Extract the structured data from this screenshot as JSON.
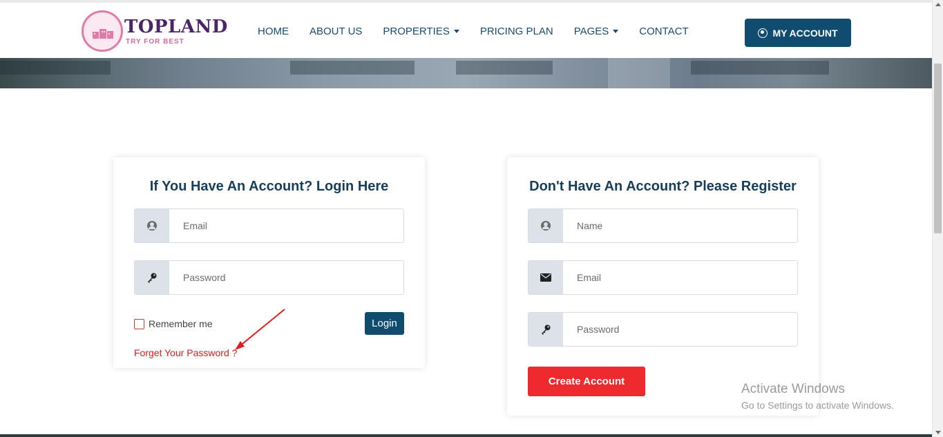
{
  "header": {
    "logo_title": "TOPLAND",
    "logo_tagline": "TRY FOR BEST",
    "nav": [
      {
        "label": "HOME",
        "dropdown": false
      },
      {
        "label": "ABOUT US",
        "dropdown": false
      },
      {
        "label": "PROPERTIES",
        "dropdown": true
      },
      {
        "label": "PRICING PLAN",
        "dropdown": false
      },
      {
        "label": "PAGES",
        "dropdown": true
      },
      {
        "label": "CONTACT",
        "dropdown": false
      }
    ],
    "account_button": "MY ACCOUNT"
  },
  "login": {
    "title": "If You Have An Account? Login Here",
    "email_placeholder": "Email",
    "password_placeholder": "Password",
    "remember_label": "Remember me",
    "login_button": "Login",
    "forgot_link": "Forget Your Password ?"
  },
  "register": {
    "title": "Don't Have An Account? Please Register",
    "name_placeholder": "Name",
    "email_placeholder": "Email",
    "password_placeholder": "Password",
    "create_button": "Create Account"
  },
  "watermark": {
    "title": "Activate Windows",
    "subtitle": "Go to Settings to activate Windows."
  },
  "icons": {
    "user": "user-icon",
    "key": "key-icon",
    "envelope": "envelope-icon",
    "account": "user-circle-icon"
  },
  "colors": {
    "primary": "#0f4c70",
    "danger": "#ee2a2e",
    "link_red": "#d1201f",
    "heading": "#173e58"
  }
}
